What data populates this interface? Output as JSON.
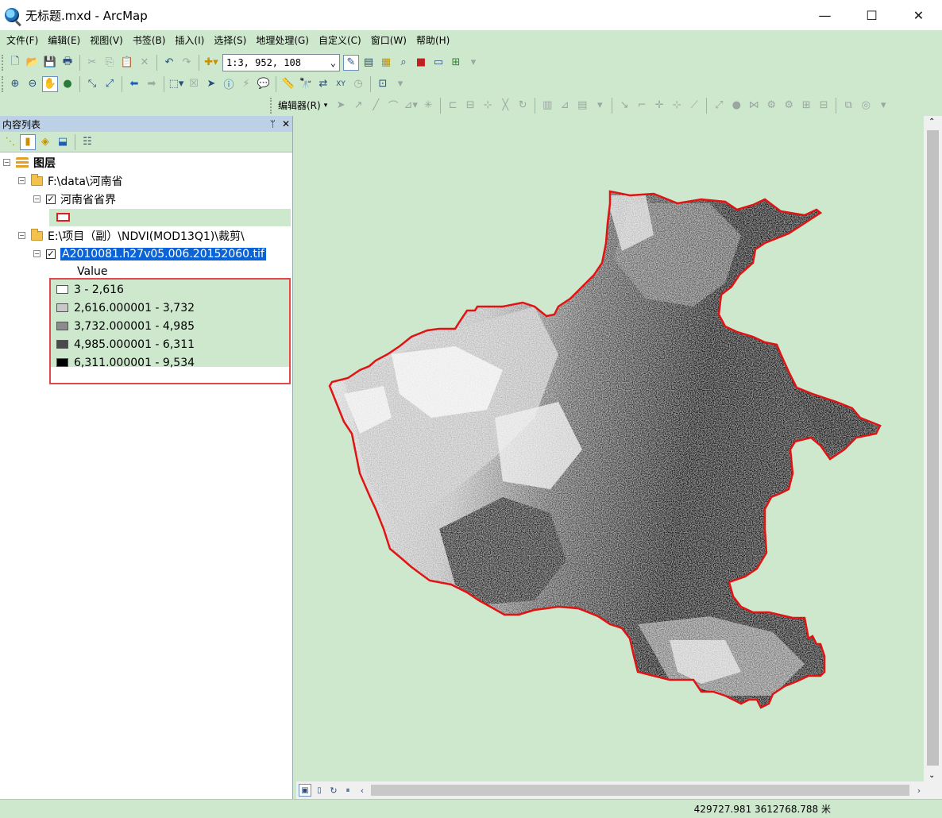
{
  "window": {
    "title": "无标题.mxd - ArcMap",
    "controls": {
      "minimize": "—",
      "maximize": "☐",
      "close": "✕"
    }
  },
  "menu": [
    "文件(F)",
    "编辑(E)",
    "视图(V)",
    "书签(B)",
    "插入(I)",
    "选择(S)",
    "地理处理(G)",
    "自定义(C)",
    "窗口(W)",
    "帮助(H)"
  ],
  "toolbar": {
    "scale_value": "1:3, 952, 108",
    "editor_label": "编辑器(R)"
  },
  "toc": {
    "title": "内容列表",
    "pin": "ᛘ",
    "close": "✕",
    "root_label": "图层",
    "group1_label": "F:\\data\\河南省",
    "layer1_label": "河南省省界",
    "group2_label": "E:\\项目（副）\\NDVI(MOD13Q1)\\裁剪\\",
    "layer2_label": "A2010081.h27v05.006.20152060.tif",
    "field_label": "Value",
    "classes": [
      {
        "label": "3 - 2,616",
        "color": "#ffffff"
      },
      {
        "label": "2,616.000001 - 3,732",
        "color": "#c8c8c8"
      },
      {
        "label": "3,732.000001 - 4,985",
        "color": "#8c8c8c"
      },
      {
        "label": "4,985.000001 - 6,311",
        "color": "#4a4a4a"
      },
      {
        "label": "6,311.000001 - 9,534",
        "color": "#000000"
      }
    ]
  },
  "status": {
    "coordinates": "429727.981  3612768.788 米"
  },
  "colors": {
    "background": "#cde8cd",
    "boundary": "#e01414",
    "selection": "#0a64d8"
  }
}
